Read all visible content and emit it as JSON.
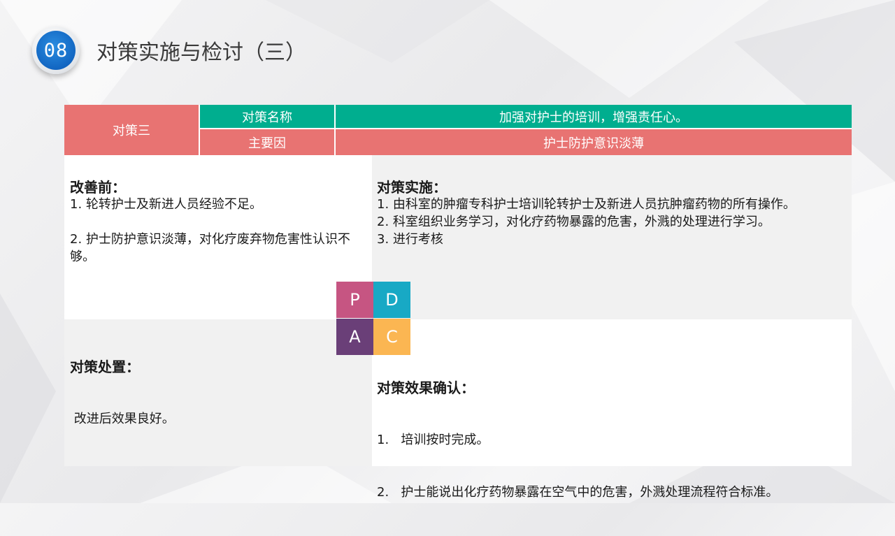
{
  "header": {
    "badge_number": "08",
    "title": "对策实施与检讨（三）"
  },
  "table": {
    "label": "对策三",
    "name_label": "对策名称",
    "name_value": "加强对护士的培训，增强责任心。",
    "cause_label": "主要因",
    "cause_value": "护士防护意识淡薄"
  },
  "before": {
    "title": "改善前：",
    "lines": [
      "1. 轮转护士及新进人员经验不足。",
      "",
      "2. 护士防护意识淡薄，对化疗废弃物危害性认识不够。"
    ]
  },
  "implementation": {
    "title": "对策实施：",
    "lines": [
      "1. 由科室的肿瘤专科护士培训轮转护士及新进人员抗肿瘤药物的所有操作。",
      "2. 科室组织业务学习，对化疗药物暴露的危害，外溅的处理进行学习。",
      "3. 进行考核"
    ]
  },
  "handling": {
    "title": "对策处置：",
    "lines": [
      " 改进后效果良好。"
    ]
  },
  "effect": {
    "title": "对策效果确认：",
    "lines": [
      "1.   培训按时完成。",
      "2.   护士能说出化疗药物暴露在空气中的危害，外溅处理流程符合标准。"
    ]
  },
  "pdca": {
    "p": "P",
    "d": "D",
    "a": "A",
    "c": "C"
  },
  "colors": {
    "teal": "#00ae8f",
    "coral": "#e87372",
    "badge_blue": "#1266c2",
    "p": "#c65582",
    "d": "#18a9c5",
    "a": "#6a3f78",
    "c": "#fbb652"
  }
}
